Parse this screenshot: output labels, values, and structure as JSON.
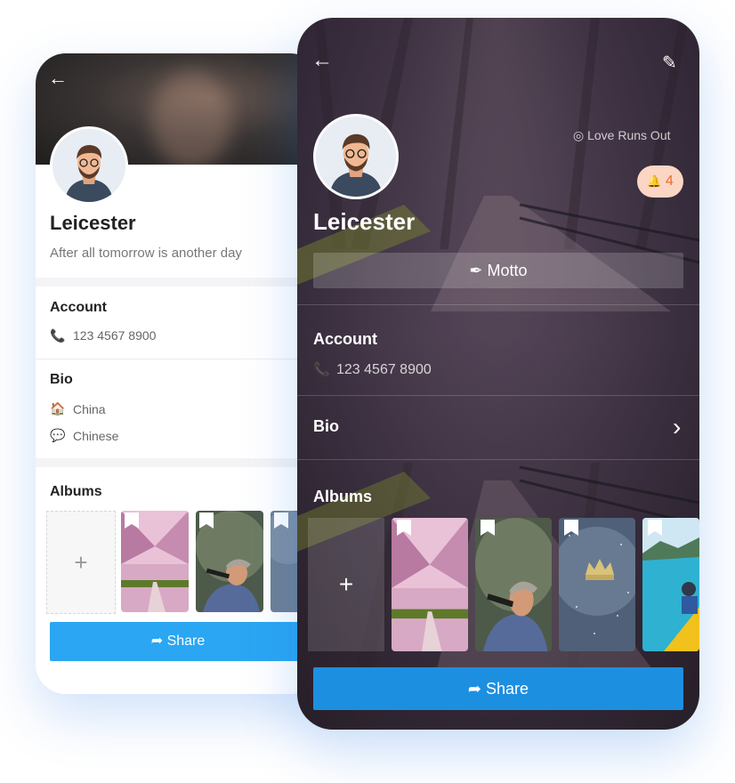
{
  "back_card": {
    "name": "Leicester",
    "motto": "After all tomorrow is another day",
    "account_label": "Account",
    "phone": "123 4567 8900",
    "bio_label": "Bio",
    "bio_items": [
      {
        "icon": "house-icon",
        "glyph": "🏠",
        "text": "China"
      },
      {
        "icon": "speech-bubble-icon",
        "glyph": "💬",
        "text": "Chinese"
      }
    ],
    "albums_label": "Albums",
    "add_glyph": "+",
    "share_label": "Share"
  },
  "front_card": {
    "name": "Leicester",
    "song_title": "Love Runs Out",
    "badge_count": "4",
    "motto_button": "Motto",
    "account_label": "Account",
    "phone": "123 4567 8900",
    "bio_label": "Bio",
    "albums_label": "Albums",
    "add_glyph": "+",
    "share_label": "Share"
  },
  "icons": {
    "back_arrow": "←",
    "edit": "✎",
    "chevron_right": "›",
    "phone": "📞",
    "share": "➦",
    "feather": "✒",
    "bell": "🔔",
    "disc": "◎"
  },
  "colors": {
    "accent_blue": "#2aa6f2",
    "front_share_blue": "#1d8fe1",
    "badge_bg": "#fbd6c4",
    "badge_fg": "#ee6b2e"
  }
}
